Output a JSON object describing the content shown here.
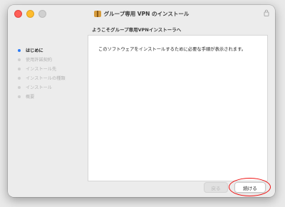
{
  "window": {
    "title": "グループ専用 VPN のインストール"
  },
  "subtitle": "ようこそグループ専用VPNインストーラへ",
  "sidebar": {
    "steps": [
      {
        "label": "はじめに",
        "active": true
      },
      {
        "label": "使用許諾契約",
        "active": false
      },
      {
        "label": "インストール先",
        "active": false
      },
      {
        "label": "インストールの種類",
        "active": false
      },
      {
        "label": "インストール",
        "active": false
      },
      {
        "label": "概要",
        "active": false
      }
    ]
  },
  "content": {
    "text": "このソフトウェアをインストールするために必要な手順が表示されます。"
  },
  "buttons": {
    "back": "戻る",
    "continue": "続ける"
  },
  "colors": {
    "accent": "#2b7bf6",
    "highlight": "#e11111"
  },
  "icons": {
    "package": "package-icon",
    "lock": "lock-icon"
  }
}
